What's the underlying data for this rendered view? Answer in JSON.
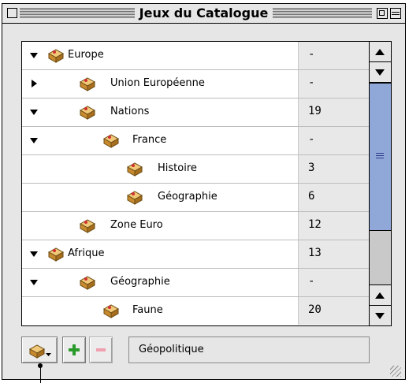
{
  "window": {
    "title": "Jeux du Catalogue"
  },
  "rows": [
    {
      "name": "Europe",
      "value": "-"
    },
    {
      "name": "Union Européenne",
      "value": "-"
    },
    {
      "name": "Nations",
      "value": "19"
    },
    {
      "name": "France",
      "value": "-"
    },
    {
      "name": "Histoire",
      "value": "3"
    },
    {
      "name": "Géographie",
      "value": "6"
    },
    {
      "name": "Zone Euro",
      "value": "12"
    },
    {
      "name": "Afrique",
      "value": "13"
    },
    {
      "name": "Géographie",
      "value": "-"
    },
    {
      "name": "Faune",
      "value": "20"
    }
  ],
  "field": {
    "value": "Géopolitique"
  },
  "icons": {
    "row_icon": "package-box-icon",
    "expand_open": "disclosure-triangle-down-icon",
    "expand_closed": "disclosure-triangle-right-icon",
    "add": "plus-icon",
    "remove": "minus-icon",
    "menu": "box-menu-icon"
  },
  "colors": {
    "thumb": "#8fa8d8",
    "add_green": "#2a9a2a",
    "remove_pink": "#f0a0b0",
    "box_tan": "#d9a24a"
  }
}
